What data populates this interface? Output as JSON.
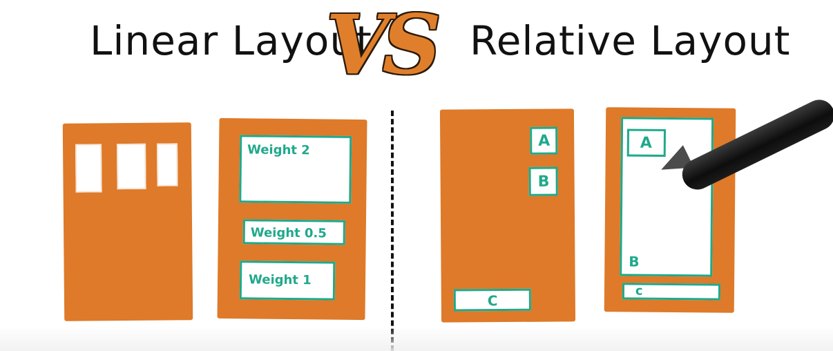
{
  "title": {
    "left": "Linear Layout",
    "vs": "VS",
    "right": "Relative Layout"
  },
  "linear_weighted": {
    "weight_2": "Weight 2",
    "weight_0_5": "Weight 0.5",
    "weight_1": "Weight 1"
  },
  "relative_simple": {
    "a": "A",
    "b": "B",
    "c": "C"
  },
  "relative_fill": {
    "a": "A",
    "b": "B",
    "c": "c"
  },
  "colors": {
    "panel": "#DE7A29",
    "outline": "#1FA98B",
    "vs": "#E07F2B"
  }
}
